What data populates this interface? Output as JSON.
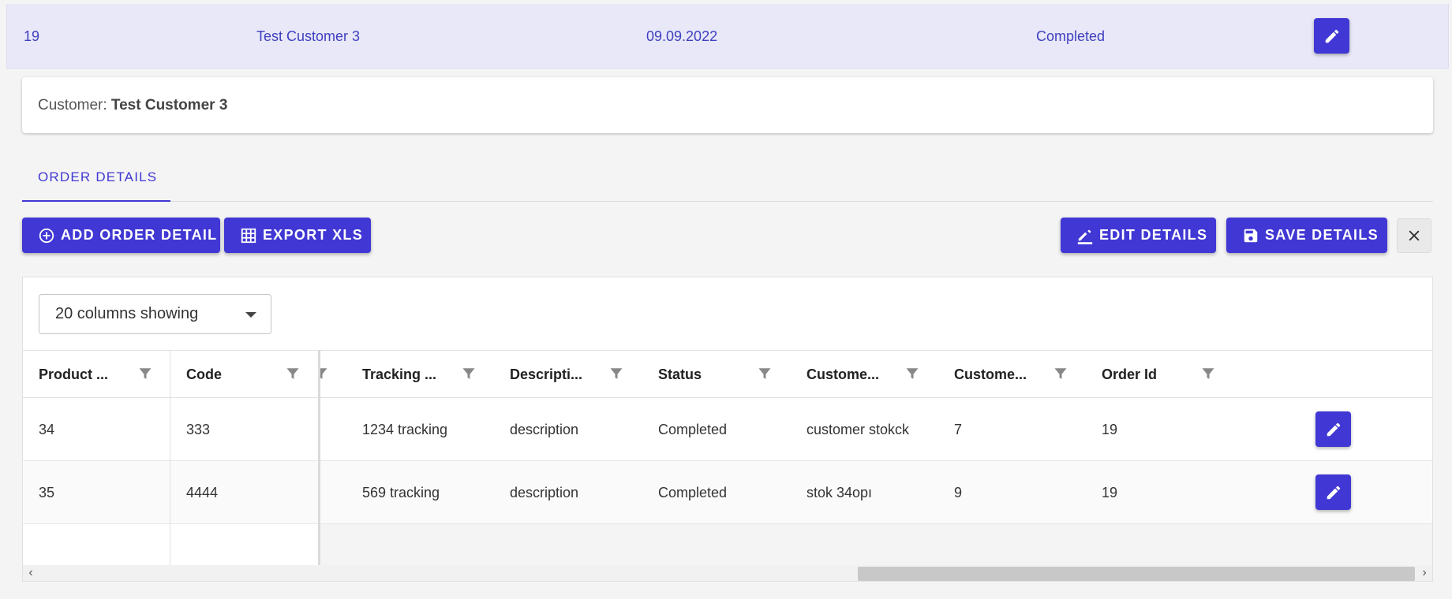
{
  "master_row": {
    "id": "19",
    "customer": "Test Customer 3",
    "date": "09.09.2022",
    "status": "Completed"
  },
  "customer_card": {
    "label": "Customer: ",
    "name": "Test Customer 3"
  },
  "tabs": [
    {
      "label": "ORDER DETAILS",
      "active": true
    }
  ],
  "toolbar": {
    "add_label": "ADD ORDER DETAIL",
    "export_label": "EXPORT XLS",
    "edit_label": "EDIT DETAILS",
    "save_label": "SAVE DETAILS"
  },
  "column_selector": {
    "value": "20 columns showing"
  },
  "grid": {
    "columns": [
      "Product ...",
      "Code",
      "Tracking ...",
      "Descripti...",
      "Status",
      "Custome...",
      "Custome...",
      "Order Id"
    ],
    "rows": [
      [
        "34",
        "333",
        "1234 tracking",
        "description",
        "Completed",
        "customer stokck",
        "7",
        "19"
      ],
      [
        "35",
        "4444",
        "569 tracking",
        "description",
        "Completed",
        "stok 34opı",
        "9",
        "19"
      ]
    ]
  },
  "colors": {
    "accent": "#4037d4",
    "master_row_bg": "#e8e8f8",
    "master_row_text": "#3f3fc0"
  },
  "icons": [
    "pencil-icon",
    "add-circle-icon",
    "grid-table-icon",
    "edit-pen-icon",
    "save-floppy-icon",
    "close-icon",
    "filter-icon",
    "chevron-left-icon",
    "chevron-right-icon"
  ]
}
